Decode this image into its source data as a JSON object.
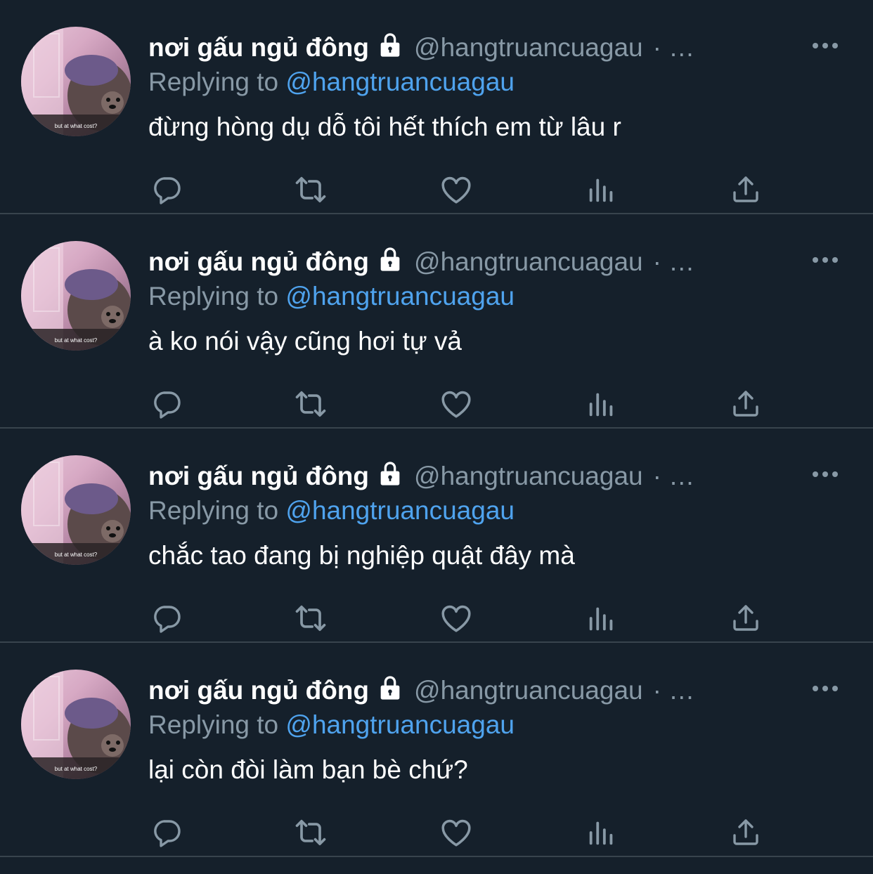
{
  "colors": {
    "background": "#15202b",
    "divider": "#38444d",
    "muted": "#8899a6",
    "link": "#4fa3ee",
    "text": "#ffffff"
  },
  "icons": {
    "more": "more-horizontal-icon",
    "lock": "lock-icon",
    "reply": "reply-icon",
    "retweet": "retweet-icon",
    "like": "heart-icon",
    "analytics": "analytics-icon",
    "share": "share-icon"
  },
  "tweets": [
    {
      "name": "nơi gấu ngủ đông",
      "handle": "@hangtruancuagau",
      "separator": "· …",
      "reply_prefix": "Replying to",
      "reply_to": "@hangtruancuagau",
      "text": "đừng hòng dụ dỗ tôi hết thích em từ lâu r",
      "avatar_caption": "but at what cost?"
    },
    {
      "name": "nơi gấu ngủ đông",
      "handle": "@hangtruancuagau",
      "separator": "· …",
      "reply_prefix": "Replying to",
      "reply_to": "@hangtruancuagau",
      "text": "à ko nói vậy cũng hơi tự vả",
      "avatar_caption": "but at what cost?"
    },
    {
      "name": "nơi gấu ngủ đông",
      "handle": "@hangtruancuagau",
      "separator": "· …",
      "reply_prefix": "Replying to",
      "reply_to": "@hangtruancuagau",
      "text": "chắc tao đang bị nghiệp quật đây mà",
      "avatar_caption": "but at what cost?"
    },
    {
      "name": "nơi gấu ngủ đông",
      "handle": "@hangtruancuagau",
      "separator": "· …",
      "reply_prefix": "Replying to",
      "reply_to": "@hangtruancuagau",
      "text": "lại còn đòi làm bạn bè chứ?",
      "avatar_caption": "but at what cost?"
    }
  ]
}
